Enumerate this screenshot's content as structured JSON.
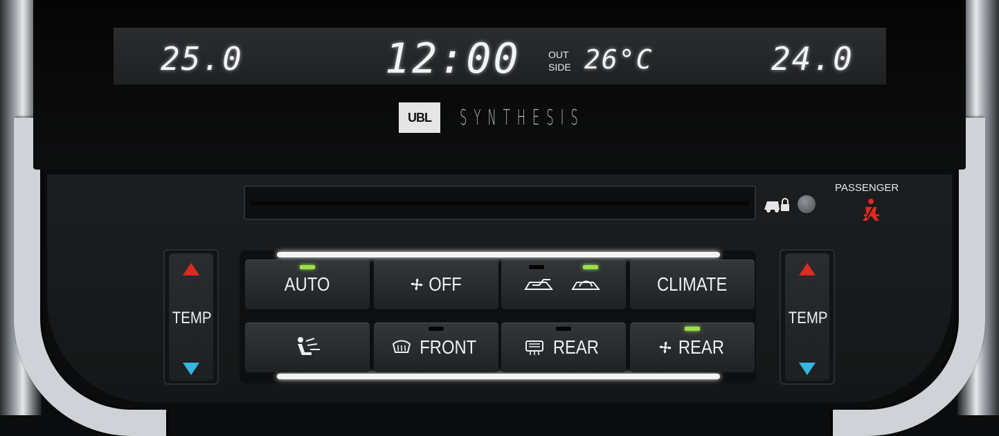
{
  "display": {
    "temp_left": "25.0",
    "clock": "12:00",
    "outside_label_1": "OUT",
    "outside_label_2": "SIDE",
    "outside_temp": "26°C",
    "temp_right": "24.0"
  },
  "brand": {
    "logo_text": "UBL",
    "name": "SYNTHESIS"
  },
  "passenger": {
    "label": "PASSENGER",
    "airbag_icon_color": "#e02a1f"
  },
  "left_temp": {
    "label": "TEMP"
  },
  "right_temp": {
    "label": "TEMP"
  },
  "buttons": {
    "auto": {
      "label": "AUTO",
      "indicator": "on"
    },
    "fan_off": {
      "label": "OFF"
    },
    "recirc": {
      "indicator_left": "off",
      "indicator_right": "on"
    },
    "climate": {
      "label": "CLIMATE"
    },
    "airflow": {
      "icon": "airflow-mode-icon"
    },
    "front": {
      "label": "FRONT",
      "indicator": "off"
    },
    "rear_defog": {
      "label": "REAR",
      "indicator": "off"
    },
    "rear_fan": {
      "label": "REAR",
      "indicator": "on"
    }
  },
  "colors": {
    "indicator_on": "#9be04a",
    "temp_up": "#e02a1f",
    "temp_down": "#33b6dd"
  }
}
